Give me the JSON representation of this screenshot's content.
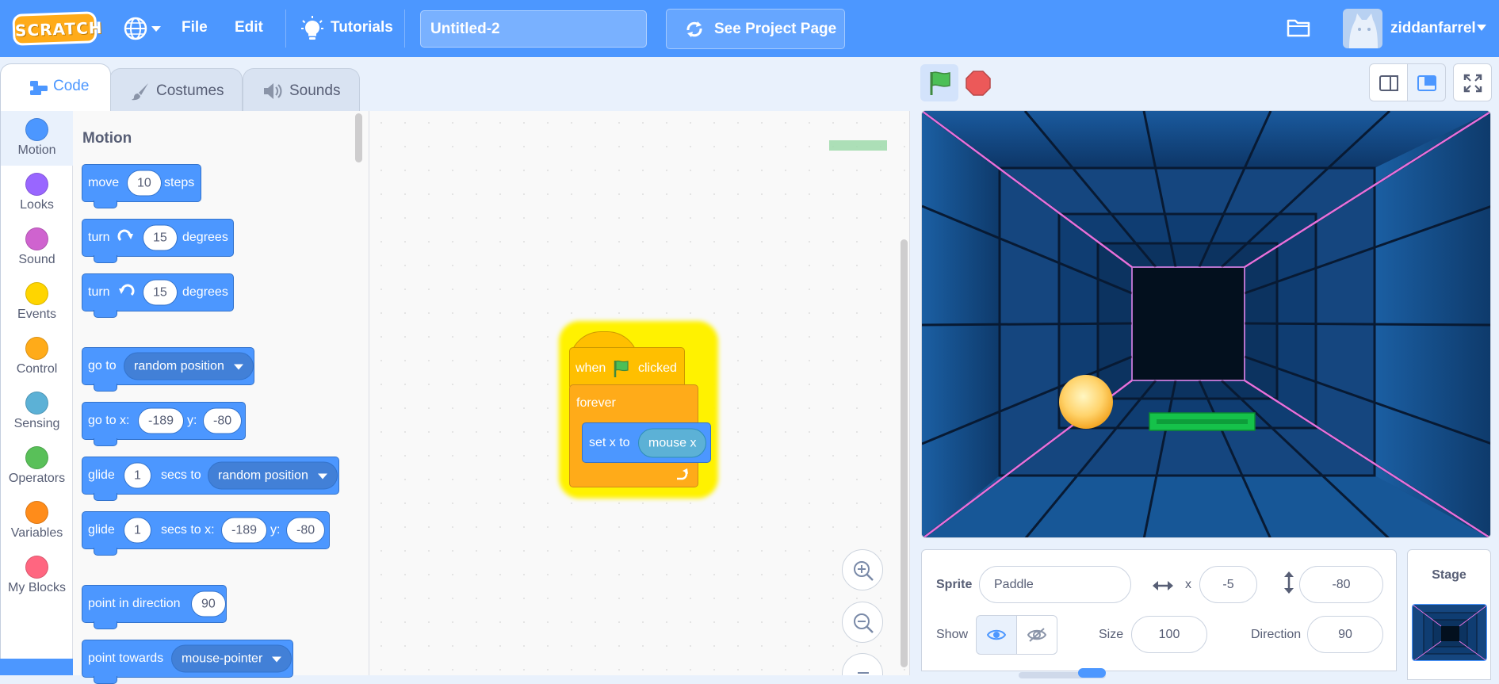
{
  "menubar": {
    "logo_text": "SCRATCH",
    "file": "File",
    "edit": "Edit",
    "tutorials": "Tutorials",
    "project_title": "Untitled-2",
    "see_project_page": "See Project Page",
    "username": "ziddanfarrel",
    "colors": {
      "bar": "#4c97ff",
      "logo": "#ffab19"
    }
  },
  "tabs": [
    {
      "label": "Code",
      "icon": "code-icon",
      "active": true
    },
    {
      "label": "Costumes",
      "icon": "brush-icon",
      "active": false
    },
    {
      "label": "Sounds",
      "icon": "speaker-icon",
      "active": false
    }
  ],
  "categories": [
    {
      "label": "Motion",
      "color": "#4c97ff",
      "selected": true
    },
    {
      "label": "Looks",
      "color": "#9966ff"
    },
    {
      "label": "Sound",
      "color": "#cf63cf"
    },
    {
      "label": "Events",
      "color": "#ffd500"
    },
    {
      "label": "Control",
      "color": "#ffab19"
    },
    {
      "label": "Sensing",
      "color": "#5cb1d6"
    },
    {
      "label": "Operators",
      "color": "#59c059"
    },
    {
      "label": "Variables",
      "color": "#ff8c1a"
    },
    {
      "label": "My Blocks",
      "color": "#ff6680"
    }
  ],
  "palette": {
    "section_title": "Motion",
    "move": {
      "label": "move",
      "value": "10",
      "suffix": "steps"
    },
    "turn_right": {
      "label": "turn",
      "value": "15",
      "suffix": "degrees",
      "icon": "rotate-right-icon"
    },
    "turn_left": {
      "label": "turn",
      "value": "15",
      "suffix": "degrees",
      "icon": "rotate-left-icon"
    },
    "goto": {
      "label": "go to",
      "option": "random position"
    },
    "goto_xy": {
      "label": "go to x:",
      "x": "-189",
      "ylabel": "y:",
      "y": "-80"
    },
    "glide": {
      "label": "glide",
      "secs": "1",
      "mid": "secs to",
      "option": "random position"
    },
    "glide_xy": {
      "label": "glide",
      "secs": "1",
      "mid": "secs to x:",
      "x": "-189",
      "ylabel": "y:",
      "y": "-80"
    },
    "point_dir": {
      "label": "point in direction",
      "value": "90"
    },
    "point_towards": {
      "label": "point towards",
      "option": "mouse-pointer"
    }
  },
  "script": {
    "hat": {
      "before": "when",
      "after": "clicked",
      "icon": "green-flag-icon"
    },
    "forever": "forever",
    "setx": {
      "label": "set x to",
      "reporter": "mouse x"
    }
  },
  "sprite_info": {
    "sprite_label": "Sprite",
    "sprite_name": "Paddle",
    "x_label": "x",
    "x": "-5",
    "y_label": "y",
    "y": "-80",
    "show_label": "Show",
    "size_label": "Size",
    "size": "100",
    "direction_label": "Direction",
    "direction": "90"
  },
  "stage_pane": {
    "label": "Stage"
  }
}
